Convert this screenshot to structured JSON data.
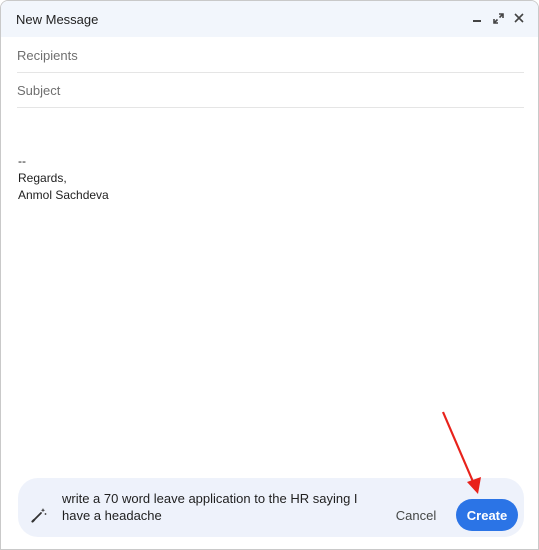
{
  "window": {
    "title": "New Message",
    "controls": [
      "minimize-icon",
      "expand-icon",
      "close-icon"
    ]
  },
  "fields": {
    "recipients_placeholder": "Recipients",
    "subject_placeholder": "Subject"
  },
  "body": {
    "lines": [
      "--",
      "Regards,",
      "Anmol Sachdeva"
    ]
  },
  "prompt": {
    "icon": "pen-sparkle-icon",
    "line1": "write a 70 word leave application to the HR saying I",
    "line2": "have a headache",
    "cancel_label": "Cancel",
    "create_label": "Create"
  },
  "annotation": {
    "arrow_color": "#e8221b"
  },
  "colors": {
    "titlebar": "#f2f6fc",
    "prompt_bg": "#eef2fb",
    "accent": "#2b74e6"
  }
}
